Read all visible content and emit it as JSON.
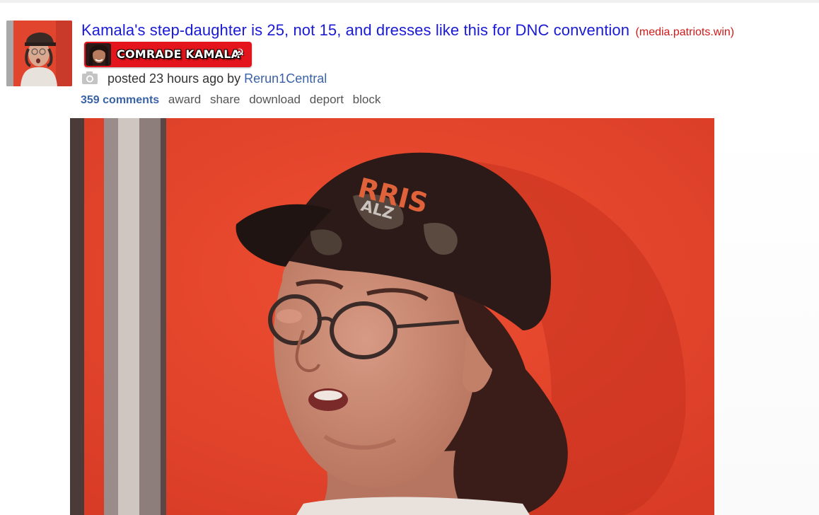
{
  "post": {
    "title": "Kamala's step-daughter is 25, not 15, and dresses like this for DNC convention",
    "domain": "(media.patriots.win)",
    "flair": {
      "text": "COMRADE KAMALA",
      "symbol_icon": "hammer-sickle-icon",
      "background": "#e3141b"
    },
    "meta": {
      "type_icon": "camera-icon",
      "posted_prefix": "posted 23 hours ago by",
      "author": "Rerun1Central"
    },
    "actions": {
      "comments": "359 comments",
      "award": "award",
      "share": "share",
      "download": "download",
      "deport": "deport",
      "block": "block"
    },
    "hat_text_1": "RRIS",
    "hat_text_2": "ALZ"
  },
  "colors": {
    "title_link": "#1a1ad6",
    "domain": "#d01a1a",
    "author_link": "#3a62a6",
    "image_background": "#e8442c"
  }
}
